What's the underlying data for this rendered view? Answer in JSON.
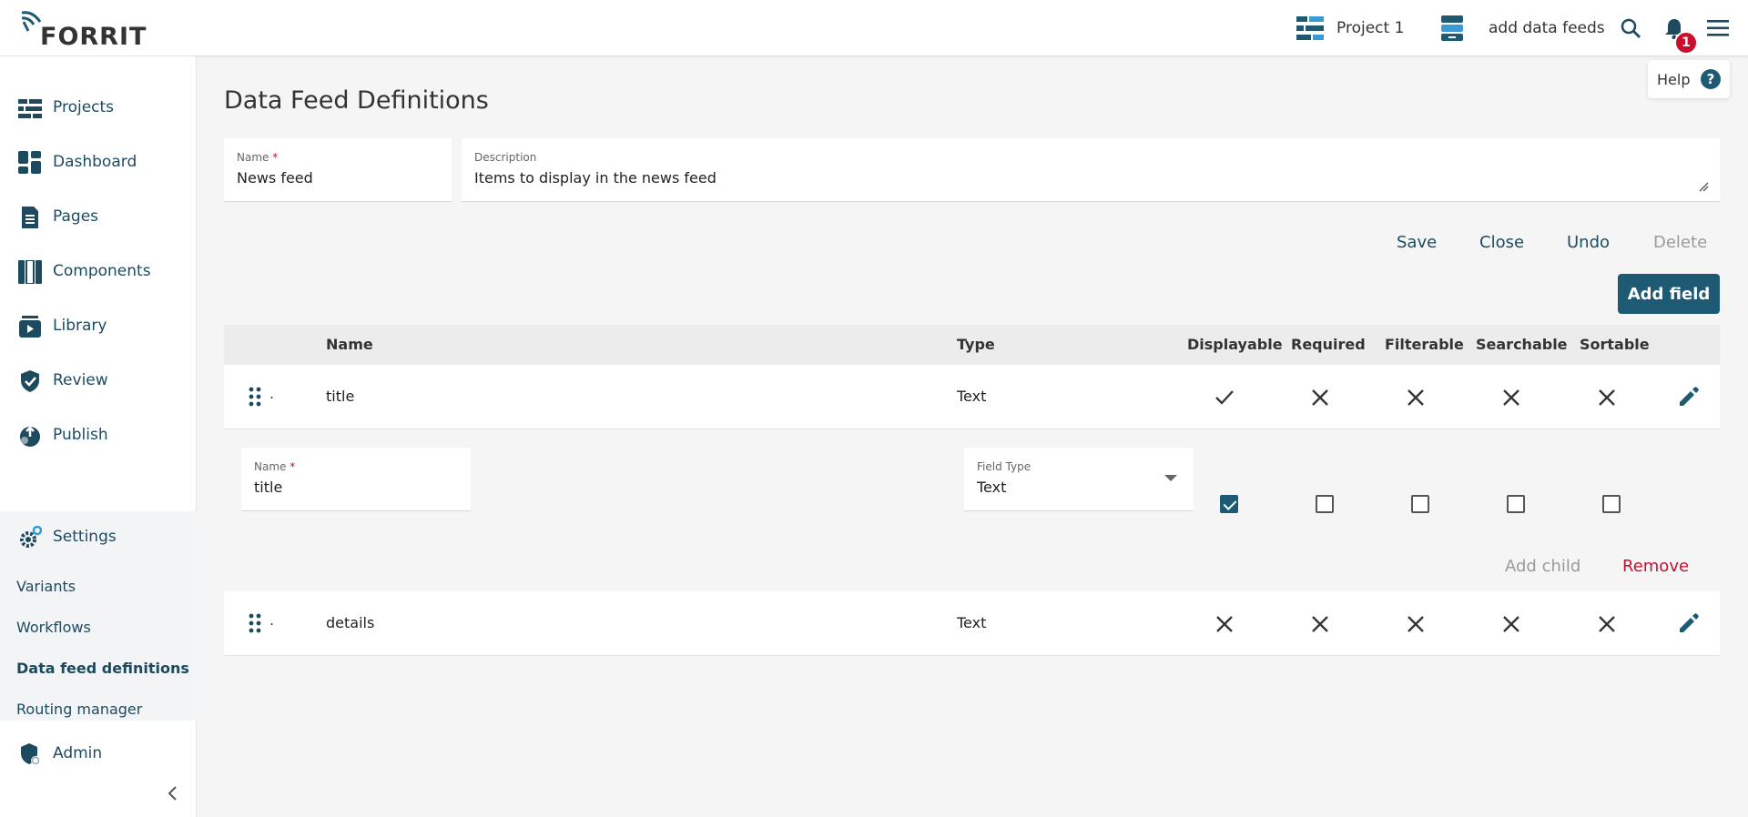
{
  "header": {
    "logo": "FORRIT",
    "project": "Project 1",
    "data_feeds": "add data feeds",
    "notifications_count": "1",
    "help": "Help",
    "help_icon": "?"
  },
  "sidebar": {
    "items": [
      {
        "label": "Projects",
        "icon": "projects-icon"
      },
      {
        "label": "Dashboard",
        "icon": "dashboard-icon"
      },
      {
        "label": "Pages",
        "icon": "pages-icon"
      },
      {
        "label": "Components",
        "icon": "components-icon"
      },
      {
        "label": "Library",
        "icon": "library-icon"
      },
      {
        "label": "Review",
        "icon": "review-icon"
      },
      {
        "label": "Publish",
        "icon": "publish-icon"
      }
    ],
    "settings": {
      "label": "Settings",
      "sub_items": [
        "Variants",
        "Workflows",
        "Data feed definitions",
        "Routing manager"
      ],
      "active": "Data feed definitions"
    },
    "admin": "Admin"
  },
  "main": {
    "title": "Data Feed Definitions",
    "name_field": {
      "label": "Name",
      "required": "*",
      "value": "News feed"
    },
    "description_field": {
      "label": "Description",
      "value": "Items to display in the news feed"
    },
    "actions": {
      "save": "Save",
      "close": "Close",
      "undo": "Undo",
      "delete": "Delete"
    },
    "add_field": "Add field",
    "table": {
      "headers": {
        "name": "Name",
        "type": "Type",
        "displayable": "Displayable",
        "required": "Required",
        "filterable": "Filterable",
        "searchable": "Searchable",
        "sortable": "Sortable"
      },
      "rows": [
        {
          "name": "title",
          "type": "Text",
          "displayable": true,
          "required": false,
          "filterable": false,
          "searchable": false,
          "sortable": false
        },
        {
          "name": "details",
          "type": "Text",
          "displayable": false,
          "required": false,
          "filterable": false,
          "searchable": false,
          "sortable": false
        }
      ],
      "row_marker": "."
    },
    "edit_panel": {
      "name_label": "Name",
      "name_required": "*",
      "name_value": "title",
      "type_label": "Field Type",
      "type_value": "Text",
      "checks": {
        "displayable": true,
        "required": false,
        "filterable": false,
        "searchable": false,
        "sortable": false
      },
      "add_child": "Add child",
      "remove": "Remove"
    }
  },
  "colors": {
    "accent": "#1e5a73",
    "danger": "#c8102e",
    "nav_text": "#1e4a60"
  }
}
